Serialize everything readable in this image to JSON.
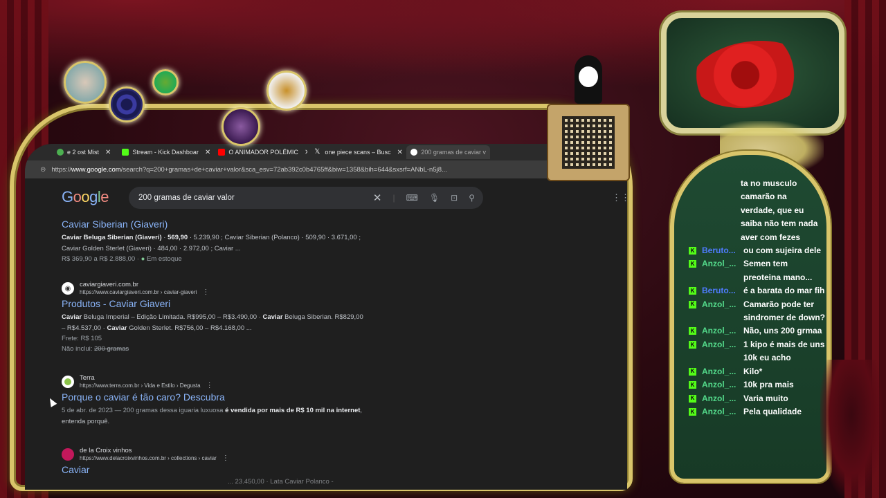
{
  "colors": {
    "accent_link": "#8ab4f8",
    "gold_frame": "#d9c56a",
    "chat_bg": "#1f4a32",
    "kick_green": "#53fc18"
  },
  "browser": {
    "tabs": [
      {
        "label": "e 2 ost Mist",
        "icon": "green-avatar-icon"
      },
      {
        "label": "Stream - Kick Dashboar",
        "icon": "kick-icon"
      },
      {
        "label": "O ANIMADOR POLÊMIC",
        "icon": "youtube-icon"
      },
      {
        "label": "one piece scans – Busc",
        "icon": "x-icon"
      },
      {
        "label": "200 gramas de caviar v",
        "icon": "google-icon"
      }
    ],
    "url_prefix": "https://",
    "url_domain": "www.google.com",
    "url_rest": "/search?q=200+gramas+de+caviar+valor&sca_esv=72ab392c0b4765ff&biw=1358&bih=644&sxsrf=ANbL-n5j8..."
  },
  "google": {
    "logo": [
      "G",
      "o",
      "o",
      "g",
      "l",
      "e"
    ],
    "query": "200 gramas de caviar valor"
  },
  "results": [
    {
      "title": "Caviar Siberian (Giaveri)",
      "snippet_line1_bold": "Caviar Beluga Siberian (Giaveri)",
      "snippet_line1_price": "569,90",
      "snippet_line1_rest": " · 5.239,90 ; Caviar Siberian (Polanco) · 509,90 · 3.671,00 ;",
      "snippet_line2": "Caviar Golden Sterlet (Giaveri) · 484,00 · 2.972,00 ; Caviar ...",
      "price_range": "R$ 369,90 a R$ 2.888,00 ·",
      "stock": "Em estoque"
    },
    {
      "site": "caviargiaveri.com.br",
      "url": "https://www.caviargiaveri.com.br › caviar-giaveri",
      "title": "Produtos - Caviar Giaveri",
      "snippet_line1": "Beluga Imperial – Edição Limitada. R$995,00 – R$3.490,00 · ",
      "snippet_line1b": " Beluga Siberian. R$829,00",
      "snippet_line2": "– R$4.537,00 · ",
      "snippet_line2b": " Golden Sterlet. R$756,00 – R$4.168,00 ...",
      "word_caviar": "Caviar",
      "shipping": "Frete: R$ 105",
      "not_included_label": "Não inclui: ",
      "not_included_value": "200 gramas"
    },
    {
      "site": "Terra",
      "url": "https://www.terra.com.br › Vida e Estilo › Degusta",
      "title": "Porque o caviar é tão caro? Descubra",
      "date": "5 de abr. de 2023 — 200 gramas dessa iguaria luxuosa ",
      "bold": "é vendida por mais de R$ 10 mil na internet",
      "rest": ",",
      "line2": "entenda porquê."
    },
    {
      "site": "de la Croix vinhos",
      "url": "https://www.delacroixvinhos.com.br › collections › caviar",
      "title": "Caviar",
      "partial": "... 23.450,00 · Lata Caviar Polanco -"
    }
  ],
  "chat": {
    "intro": [
      "ta no musculo",
      "camarão na",
      "verdade, que eu",
      "saiba não tem nada",
      "aver com fezes"
    ],
    "messages": [
      {
        "user": "Beruto...",
        "color": "blue",
        "lines": [
          "ou com sujeira dele"
        ]
      },
      {
        "user": "Anzol_...",
        "color": "green",
        "lines": [
          "Semen tem",
          "preoteina mano..."
        ]
      },
      {
        "user": "Beruto...",
        "color": "blue",
        "lines": [
          "é a barata do mar fih"
        ]
      },
      {
        "user": "Anzol_...",
        "color": "green",
        "lines": [
          "Camarão pode ter",
          "sindromer de down?"
        ]
      },
      {
        "user": "Anzol_...",
        "color": "green",
        "lines": [
          "Não, uns 200 grmaa"
        ]
      },
      {
        "user": "Anzol_...",
        "color": "green",
        "lines": [
          "1 kipo é mais de uns",
          "10k eu acho"
        ]
      },
      {
        "user": "Anzol_...",
        "color": "green",
        "lines": [
          "Kilo*"
        ]
      },
      {
        "user": "Anzol_...",
        "color": "green",
        "lines": [
          "10k pra mais"
        ]
      },
      {
        "user": "Anzol_...",
        "color": "green",
        "lines": [
          "Varia muito"
        ]
      },
      {
        "user": "Anzol_...",
        "color": "green",
        "lines": [
          "Pela qualidade"
        ]
      }
    ]
  }
}
